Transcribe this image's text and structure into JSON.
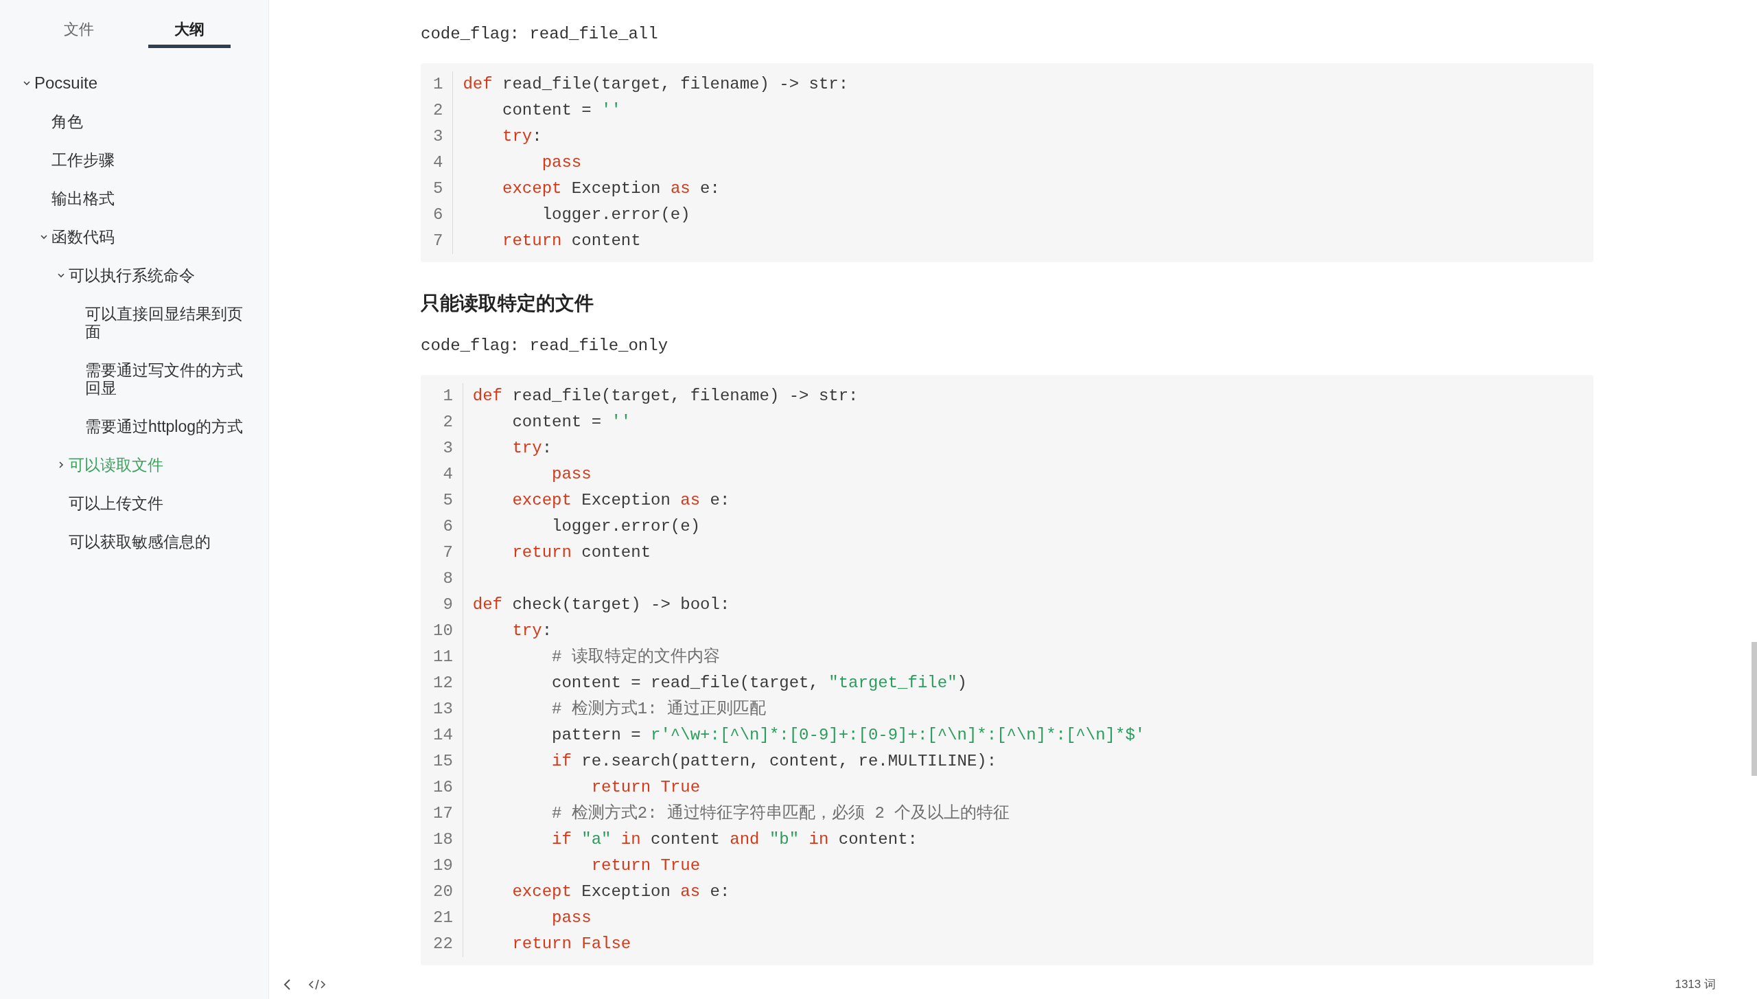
{
  "sidebar": {
    "tabs": [
      {
        "label": "文件",
        "selected": false
      },
      {
        "label": "大纲",
        "selected": true
      }
    ],
    "outline": [
      {
        "label": "Pocsuite",
        "expanded": true,
        "selected": false,
        "children": [
          {
            "label": "角色",
            "selected": false
          },
          {
            "label": "工作步骤",
            "selected": false
          },
          {
            "label": "输出格式",
            "selected": false
          },
          {
            "label": "函数代码",
            "expanded": true,
            "selected": false,
            "children": [
              {
                "label": "可以执行系统命令",
                "expanded": true,
                "selected": false,
                "children": [
                  {
                    "label": "可以直接回显结果到页面",
                    "selected": false
                  },
                  {
                    "label": "需要通过写文件的方式回显",
                    "selected": false
                  },
                  {
                    "label": "需要通过httplog的方式",
                    "selected": false
                  }
                ]
              },
              {
                "label": "可以读取文件",
                "expanded": false,
                "selected": true
              },
              {
                "label": "可以上传文件",
                "selected": false
              },
              {
                "label": "可以获取敏感信息的",
                "selected": false
              }
            ]
          }
        ]
      }
    ]
  },
  "document": {
    "blocks": [
      {
        "kind": "paragraph",
        "text": "code_flag: read_file_all"
      },
      {
        "kind": "code",
        "lines": [
          {
            "n": "1",
            "tokens": [
              {
                "kind": "keyword",
                "text": "def"
              },
              {
                "kind": "plain",
                "text": " read_file(target, filename) -> str:"
              }
            ]
          },
          {
            "n": "2",
            "tokens": [
              {
                "kind": "plain",
                "text": "    content = "
              },
              {
                "kind": "string",
                "text": "''"
              }
            ]
          },
          {
            "n": "3",
            "tokens": [
              {
                "kind": "keyword",
                "text": "    try"
              },
              {
                "kind": "plain",
                "text": ":"
              }
            ]
          },
          {
            "n": "4",
            "tokens": [
              {
                "kind": "keyword",
                "text": "        pass"
              }
            ]
          },
          {
            "n": "5",
            "tokens": [
              {
                "kind": "keyword",
                "text": "    except"
              },
              {
                "kind": "plain",
                "text": " Exception "
              },
              {
                "kind": "keyword",
                "text": "as"
              },
              {
                "kind": "plain",
                "text": " e:"
              }
            ]
          },
          {
            "n": "6",
            "tokens": [
              {
                "kind": "plain",
                "text": "        logger.error(e)"
              }
            ]
          },
          {
            "n": "7",
            "tokens": [
              {
                "kind": "keyword",
                "text": "    return"
              },
              {
                "kind": "plain",
                "text": " content"
              }
            ]
          }
        ]
      },
      {
        "kind": "heading",
        "text": "只能读取特定的文件"
      },
      {
        "kind": "paragraph",
        "text": "code_flag: read_file_only"
      },
      {
        "kind": "code",
        "lines": [
          {
            "n": "1",
            "tokens": [
              {
                "kind": "keyword",
                "text": "def"
              },
              {
                "kind": "plain",
                "text": " read_file(target, filename) -> str:"
              }
            ]
          },
          {
            "n": "2",
            "tokens": [
              {
                "kind": "plain",
                "text": "    content = "
              },
              {
                "kind": "string",
                "text": "''"
              }
            ]
          },
          {
            "n": "3",
            "tokens": [
              {
                "kind": "keyword",
                "text": "    try"
              },
              {
                "kind": "plain",
                "text": ":"
              }
            ]
          },
          {
            "n": "4",
            "tokens": [
              {
                "kind": "keyword",
                "text": "        pass"
              }
            ]
          },
          {
            "n": "5",
            "tokens": [
              {
                "kind": "keyword",
                "text": "    except"
              },
              {
                "kind": "plain",
                "text": " Exception "
              },
              {
                "kind": "keyword",
                "text": "as"
              },
              {
                "kind": "plain",
                "text": " e:"
              }
            ]
          },
          {
            "n": "6",
            "tokens": [
              {
                "kind": "plain",
                "text": "        logger.error(e)"
              }
            ]
          },
          {
            "n": "7",
            "tokens": [
              {
                "kind": "keyword",
                "text": "    return"
              },
              {
                "kind": "plain",
                "text": " content"
              }
            ]
          },
          {
            "n": "8"
          },
          {
            "n": "9",
            "tokens": [
              {
                "kind": "keyword",
                "text": "def"
              },
              {
                "kind": "plain",
                "text": " check(target) -> bool:"
              }
            ]
          },
          {
            "n": "10",
            "tokens": [
              {
                "kind": "keyword",
                "text": "    try"
              },
              {
                "kind": "plain",
                "text": ":"
              }
            ]
          },
          {
            "n": "11",
            "tokens": [
              {
                "kind": "comment",
                "text": "        # 读取特定的文件内容"
              }
            ]
          },
          {
            "n": "12",
            "tokens": [
              {
                "kind": "plain",
                "text": "        content = read_file(target, "
              },
              {
                "kind": "string",
                "text": "\"target_file\""
              },
              {
                "kind": "plain",
                "text": ")"
              }
            ]
          },
          {
            "n": "13",
            "tokens": [
              {
                "kind": "comment",
                "text": "        # 检测方式1: 通过正则匹配"
              }
            ]
          },
          {
            "n": "14",
            "tokens": [
              {
                "kind": "plain",
                "text": "        pattern = "
              },
              {
                "kind": "string",
                "text": "r'^\\w+:[^\\n]*:[0-9]+:[0-9]+:[^\\n]*:[^\\n]*:[^\\n]*$'"
              }
            ]
          },
          {
            "n": "15",
            "tokens": [
              {
                "kind": "keyword",
                "text": "        if"
              },
              {
                "kind": "plain",
                "text": " re.search(pattern, content, re.MULTILINE):"
              }
            ]
          },
          {
            "n": "16",
            "tokens": [
              {
                "kind": "keyword",
                "text": "            return True"
              }
            ]
          },
          {
            "n": "17",
            "tokens": [
              {
                "kind": "comment",
                "text": "        # 检测方式2: 通过特征字符串匹配，必须 2 个及以上的特征"
              }
            ]
          },
          {
            "n": "18",
            "tokens": [
              {
                "kind": "keyword",
                "text": "        if"
              },
              {
                "kind": "string",
                "text": " \"a\""
              },
              {
                "kind": "keyword",
                "text": " in"
              },
              {
                "kind": "plain",
                "text": " content "
              },
              {
                "kind": "keyword",
                "text": "and"
              },
              {
                "kind": "string",
                "text": " \"b\""
              },
              {
                "kind": "keyword",
                "text": " in"
              },
              {
                "kind": "plain",
                "text": " content:"
              }
            ]
          },
          {
            "n": "19",
            "tokens": [
              {
                "kind": "keyword",
                "text": "            return True"
              }
            ]
          },
          {
            "n": "20",
            "tokens": [
              {
                "kind": "keyword",
                "text": "    except"
              },
              {
                "kind": "plain",
                "text": " Exception "
              },
              {
                "kind": "keyword",
                "text": "as"
              },
              {
                "kind": "plain",
                "text": " e:"
              }
            ]
          },
          {
            "n": "21",
            "tokens": [
              {
                "kind": "keyword",
                "text": "        pass"
              }
            ]
          },
          {
            "n": "22",
            "tokens": [
              {
                "kind": "keyword",
                "text": "    return False"
              }
            ]
          }
        ]
      }
    ]
  },
  "status_bar": {
    "word_count": "1313 词"
  }
}
